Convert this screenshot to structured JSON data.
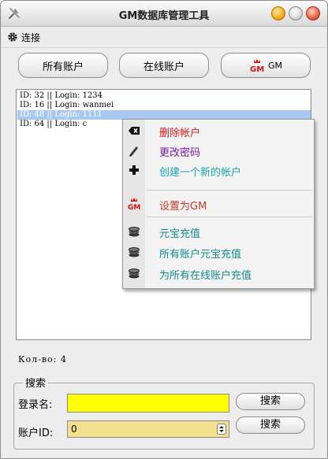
{
  "window": {
    "title": "GM数据库管理工具"
  },
  "menu": {
    "connect_label": "连接"
  },
  "toolbar": {
    "all_accounts_label": "所有账户",
    "online_accounts_label": "在线账户",
    "gm_label": "GM"
  },
  "accounts": [
    {
      "text": "ID: 32 || Login: 1234",
      "selected": false
    },
    {
      "text": "ID: 16 || Login: wanmei",
      "selected": false
    },
    {
      "text": "ID: 48 || Login: 1111",
      "selected": true
    },
    {
      "text": "ID: 64 || Login: c",
      "selected": false
    }
  ],
  "context_menu": {
    "delete_account": "删除帐户",
    "change_password": "更改密码",
    "create_account": "创建一个新的帐户",
    "set_gm": "设置为GM",
    "recharge": "元宝充值",
    "recharge_all": "所有账户元宝充值",
    "recharge_online": "为所有在线账户充值"
  },
  "status": {
    "count_text": "Кол-во: 4"
  },
  "search": {
    "group_title": "搜索",
    "login_label": "登录名:",
    "login_value": "",
    "account_id_label": "账户ID:",
    "account_id_value": "0",
    "search_button_1": "搜索",
    "search_button_2": "搜索"
  },
  "colors": {
    "delete": "#d81b1b",
    "change_password": "#7a1a9c",
    "create": "#1aa3a8",
    "set_gm": "#c0392b",
    "recharge": "#138a8a",
    "login_field_bg": "#ffff00",
    "id_field_bg": "#f2e08c"
  }
}
